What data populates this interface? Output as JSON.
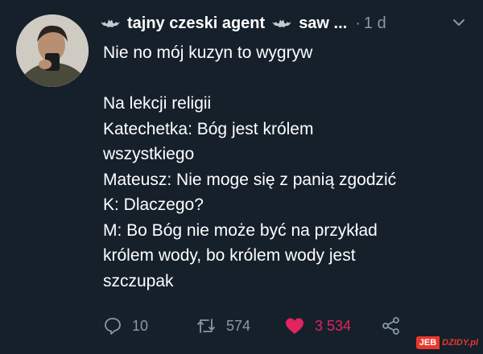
{
  "tweet": {
    "display_name": "tajny czeski agent",
    "handle_truncated": "saw ...",
    "separator": "·",
    "time_ago": "1 d",
    "text_lines": [
      "Nie no mój kuzyn to wygryw",
      "",
      "Na lekcji religii",
      "Katechetka: Bóg jest królem",
      "wszystkiego",
      "Mateusz: Nie moge się z panią zgodzić",
      "K: Dlaczego?",
      "M: Bo Bóg nie może być na przykład",
      "królem wody, bo królem wody jest",
      "szczupak"
    ],
    "replies": "10",
    "retweets": "574",
    "likes": "3 534"
  },
  "colors": {
    "background": "#15202b",
    "text": "#ffffff",
    "muted": "#8899a6",
    "like": "#e0245e"
  },
  "icons": {
    "name_prefix": "bat-icon",
    "name_suffix": "bat-icon",
    "menu": "chevron-down-icon",
    "reply": "reply-bubble-icon",
    "retweet": "retweet-icon",
    "like": "heart-icon",
    "share": "share-icon"
  },
  "watermark": {
    "part_a": "JEB",
    "part_b": "DZIDY.pl"
  }
}
